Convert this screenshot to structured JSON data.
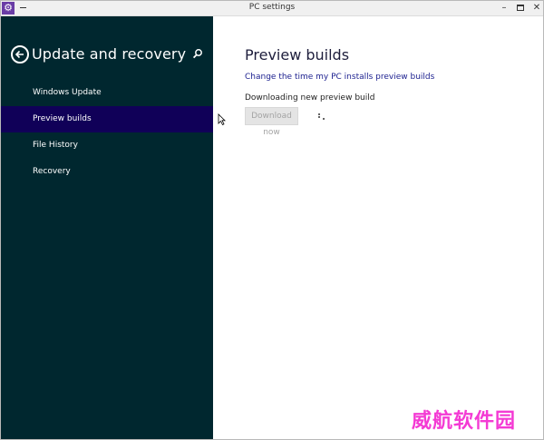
{
  "window": {
    "title": "PC settings"
  },
  "sidebar": {
    "title": "Update and recovery",
    "items": [
      {
        "label": "Windows Update",
        "selected": false
      },
      {
        "label": "Preview builds",
        "selected": true
      },
      {
        "label": "File History",
        "selected": false
      },
      {
        "label": "Recovery",
        "selected": false
      }
    ]
  },
  "main": {
    "title": "Preview builds",
    "link": "Change the time my PC installs preview builds",
    "status": "Downloading new preview build",
    "download_button": "Download now"
  },
  "watermark": "威航软件园",
  "colors": {
    "sidebar_bg": "#00272f",
    "selected_bg": "#100058",
    "link": "#1e2290",
    "accent": "#6a3da6"
  }
}
